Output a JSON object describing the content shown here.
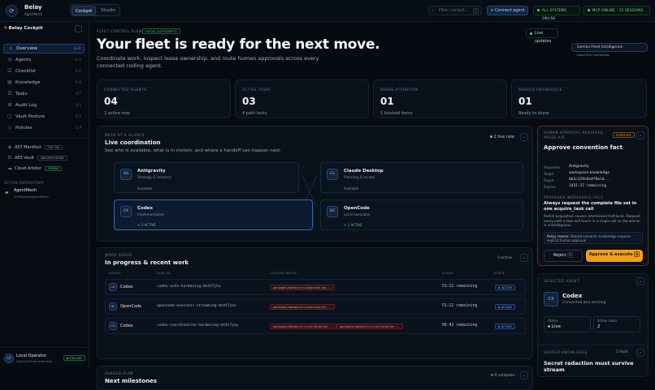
{
  "topbar": {
    "brand": "Belay",
    "brand_sub": "AgentMesh",
    "tabs": [
      {
        "label": "Cockpit",
        "active": true
      },
      {
        "label": "Studio",
        "active": false
      }
    ],
    "search_placeholder": "Filter cockpit...",
    "search_key": "/",
    "connect_label": "Connect agent",
    "status_all": "ALL SYSTEMS ONLINE",
    "status_mcp": "MCP ONLINE · 15 SESSIONS"
  },
  "sidebar": {
    "title": "Belay Cockpit",
    "nav": [
      {
        "label": "Overview",
        "key": "G O",
        "icon": "home-icon",
        "active": true
      },
      {
        "label": "Agents",
        "key": "G A",
        "icon": "agents-icon"
      },
      {
        "label": "Checklist",
        "key": "G C",
        "icon": "checklist-icon"
      },
      {
        "label": "Knowledge",
        "key": "G K",
        "icon": "book-icon"
      },
      {
        "label": "Tasks",
        "key": "G T",
        "icon": "tasks-icon"
      },
      {
        "label": "Audit Log",
        "key": "G L",
        "icon": "log-icon"
      },
      {
        "label": "Vault Posture",
        "key": "G V",
        "icon": "vault-icon"
      },
      {
        "label": "Policies",
        "key": "G P",
        "icon": "policy-icon"
      }
    ],
    "status": [
      {
        "label": "AST Manifest",
        "badge": "TSX TSX"
      },
      {
        "label": "AES Vault",
        "badge": "UNCONFIGURED"
      },
      {
        "label": "Cloud Arbiter",
        "badge": "GEMINI"
      }
    ],
    "repo_section": "ACTIVE REPOSITORY",
    "repo_name": "AgentMesh",
    "repo_path": "D:\\Projects\\AgentMesh",
    "operator_name": "Local Operator",
    "operator_role": "Control Plane Authority",
    "operator_initials": "LO",
    "operator_status": "ONLINE"
  },
  "hero": {
    "eyebrow": "FLEET CONTROL PLANE",
    "tag": "LOCAL AUTHORITY",
    "title": "Your fleet is ready for the next move.",
    "subtitle": "Coordinate work, inspect lease ownership, and route human approvals across every connected coding agent.",
    "live_label": "Live updates",
    "intel_label": "Gemini Fleet Intelligence",
    "intel_sub": "Cloud Run connected"
  },
  "stats": [
    {
      "label": "CONNECTED AGENTS",
      "value": "04",
      "sub": "2 active now"
    },
    {
      "label": "ACTIVE TASKS",
      "value": "03",
      "sub": "4 path locks"
    },
    {
      "label": "NEEDS ATTENTION",
      "value": "01",
      "sub": "1 blocked items"
    },
    {
      "label": "SHARED KNOWLEDGE",
      "value": "01",
      "sub": "Ready to share"
    }
  ],
  "mesh": {
    "eyebrow": "MESH AT A GLANCE",
    "title": "Live coordination",
    "desc": "See who is available, what is in motion, and where a handoff can happen next.",
    "live_now": "2 live now",
    "agents": [
      {
        "initials": "AG",
        "name": "Antigravity",
        "role": "Strategy & research",
        "status": "Available",
        "active": false,
        "selected": false
      },
      {
        "initials": "CL",
        "name": "Claude Desktop",
        "role": "Planning & review",
        "status": "Available",
        "active": false,
        "selected": false
      },
      {
        "initials": "CX",
        "name": "Codex",
        "role": "Implementation",
        "status": "2 ACTIVE",
        "active": true,
        "selected": true
      },
      {
        "initials": "OC",
        "name": "OpenCode",
        "role": "Local execution",
        "status": "1 ACTIVE",
        "active": true,
        "selected": false
      }
    ]
  },
  "work": {
    "eyebrow": "WORK QUEUE",
    "title": "In progress & recent work",
    "count": "3 active",
    "headers": [
      "AGENT",
      "TASK ID",
      "LOCKED PATHS",
      "LEASE",
      "STATE"
    ],
    "rows": [
      {
        "initials": "CX",
        "agent": "Codex",
        "task": "codex-auth-hardening-mt4t7jho",
        "paths": [
          "packages/daemon/src/approval/ap..."
        ],
        "lease": "51:22 remaining",
        "state": "ACTIVE"
      },
      {
        "initials": "OP",
        "agent": "OpenCode",
        "task": "opencode-executor-streaming-mt4t7jho",
        "paths": [
          "packages/daemon/src/executor/ex..."
        ],
        "lease": "51:22 remaining",
        "state": "ACTIVE"
      },
      {
        "initials": "CX",
        "agent": "Codex",
        "task": "codex-coordination-hardening-mt4t7yny",
        "paths": [
          "packages/daemon/src/coordination...",
          "packages/daemon/src/coordination..."
        ],
        "lease": "06:42 remaining",
        "state": "ACTIVE"
      }
    ]
  },
  "plan": {
    "eyebrow": "SHARED PLAN",
    "title": "Next milestones",
    "count": "0 complete"
  },
  "approval": {
    "eyebrow": "HUMAN APPROVAL REQUIRED · PRESS A/R",
    "pending": "PENDING",
    "title": "Approve convention fact",
    "fields": [
      {
        "k": "Requester",
        "v": "Antigravity"
      },
      {
        "k": "Target",
        "v": "workspace-knowledge"
      },
      {
        "k": "Digest",
        "v": "6b3c229c6e4f9ecd..."
      },
      {
        "k": "Expires",
        "v": "1431:37 remaining"
      }
    ],
    "proposed_label": "PROPOSED WORKSPACE FACT",
    "proposed_title": "Always request the complete file set in one acquire_task call",
    "proposed_desc": "Partial acquisition causes interleaved half-locks. Request every path a task will touch in a single call so the winner is unambiguous.",
    "policy_label": "Policy reason:",
    "policy_text": "Shared semantic knowledge requires explicit human approval.",
    "reject_label": "Reject",
    "reject_key": "R",
    "approve_label": "Approve & execute",
    "approve_key": "A"
  },
  "selected": {
    "eyebrow": "SELECTED AGENT",
    "initials": "CX",
    "name": "Codex",
    "sub": "Connected and working",
    "status_label": "Status",
    "status_value": "Live",
    "tasks_label": "Active tasks",
    "tasks_value": "2"
  },
  "knowledge": {
    "eyebrow": "SHARED KNOWLEDGE",
    "count": "1 facts",
    "title": "Secret redaction must survive stream"
  },
  "colors": {
    "accent": "#2f6bb8",
    "online": "#2ee37f",
    "approve": "#f0a01a"
  }
}
